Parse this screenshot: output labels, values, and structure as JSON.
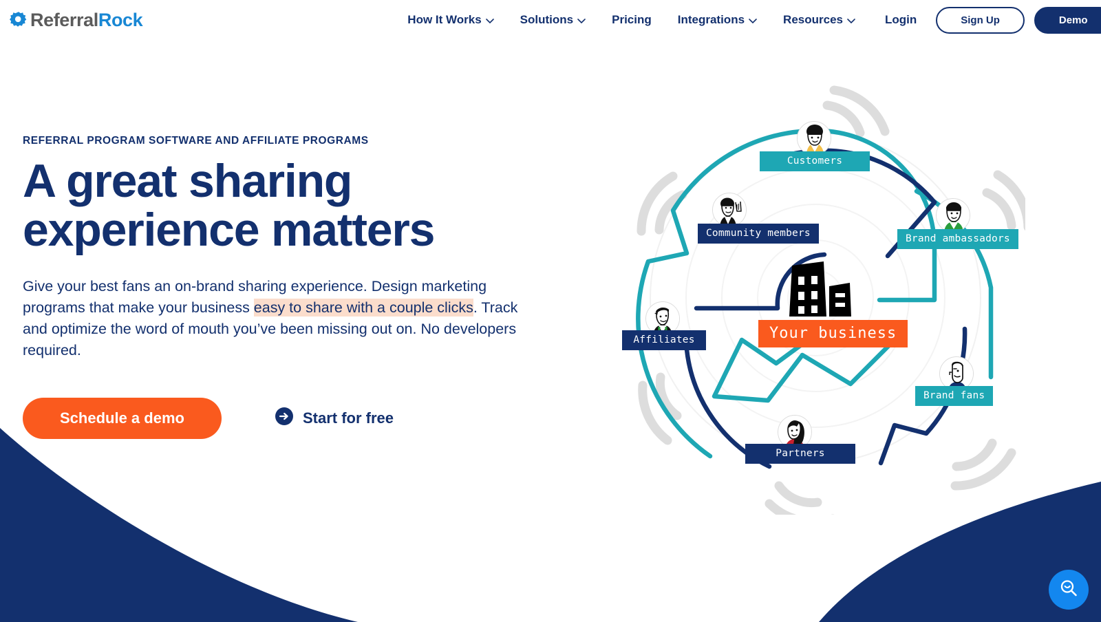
{
  "brand": {
    "logo_icon": "gear-icon",
    "name_part1": "Referral",
    "name_part2": "Rock",
    "colors": {
      "navy": "#13306e",
      "orange": "#fa5a1e",
      "teal": "#1ea7b4",
      "blue": "#1887d4",
      "highlight": "#fbddcc",
      "gray_arc": "#dddddd"
    }
  },
  "nav": {
    "items": [
      {
        "label": "How It Works",
        "has_caret": true,
        "caret_icon": "chevron-down-icon"
      },
      {
        "label": "Solutions",
        "has_caret": true,
        "caret_icon": "chevron-down-icon"
      },
      {
        "label": "Pricing",
        "has_caret": false
      },
      {
        "label": "Integrations",
        "has_caret": true,
        "caret_icon": "chevron-down-icon"
      },
      {
        "label": "Resources",
        "has_caret": true,
        "caret_icon": "chevron-down-icon"
      }
    ],
    "login_label": "Login",
    "signup_label": "Sign Up",
    "demo_label": "Demo"
  },
  "hero": {
    "eyebrow": "REFERRAL PROGRAM SOFTWARE AND AFFILIATE PROGRAMS",
    "headline_line1": "A great sharing",
    "headline_line2": "experience matters",
    "body_part1": "Give your best fans an on-brand sharing experience. Design marketing programs that make your business ",
    "body_highlight": "easy to share with a couple clicks",
    "body_part2": ". Track and optimize the word of mouth you’ve been missing out on. No developers required.",
    "primary_cta": "Schedule a demo",
    "secondary_cta": "Start for free",
    "secondary_cta_icon": "arrow-right-circle-icon"
  },
  "diagram": {
    "center_label": "Your business",
    "center_icon": "office-building-icon",
    "nodes": [
      {
        "label": "Customers",
        "style": "teal",
        "avatar": "person-afro-icon"
      },
      {
        "label": "Community members",
        "style": "navy",
        "avatar": "person-waving-icon"
      },
      {
        "label": "Brand ambassadors",
        "style": "teal",
        "avatar": "person-green-shirt-icon"
      },
      {
        "label": "Brand fans",
        "style": "teal",
        "avatar": "person-bald-icon"
      },
      {
        "label": "Partners",
        "style": "navy",
        "avatar": "person-red-hood-icon"
      },
      {
        "label": "Affiliates",
        "style": "navy",
        "avatar": "person-cap-icon"
      }
    ]
  },
  "fab": {
    "icon": "search-smile-icon",
    "title": "Search"
  }
}
